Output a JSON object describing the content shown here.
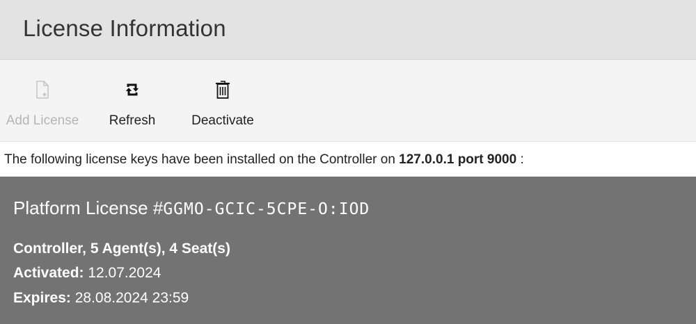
{
  "header": {
    "title": "License Information"
  },
  "toolbar": {
    "add_license": {
      "label": "Add License",
      "icon": "add-document-icon",
      "enabled": false
    },
    "refresh": {
      "label": "Refresh",
      "icon": "refresh-icon",
      "enabled": true
    },
    "deactivate": {
      "label": "Deactivate",
      "icon": "trash-icon",
      "enabled": true
    }
  },
  "info": {
    "prefix": "The following license keys have been installed on the Controller on ",
    "host": "127.0.0.1 port 9000",
    "suffix": " :"
  },
  "license": {
    "title_prefix": "Platform License #",
    "key": "GGMO-GCIC-5CPE-O:IOD",
    "features": "Controller, 5 Agent(s), 4 Seat(s)",
    "activated_label": "Activated:",
    "activated_value": " 12.07.2024",
    "expires_label": "Expires:",
    "expires_value": " 28.08.2024 23:59"
  },
  "colors": {
    "header_bg": "#e3e3e3",
    "toolbar_bg": "#f4f4f4",
    "panel_bg": "#737373",
    "disabled_text": "#b5b5b5"
  }
}
